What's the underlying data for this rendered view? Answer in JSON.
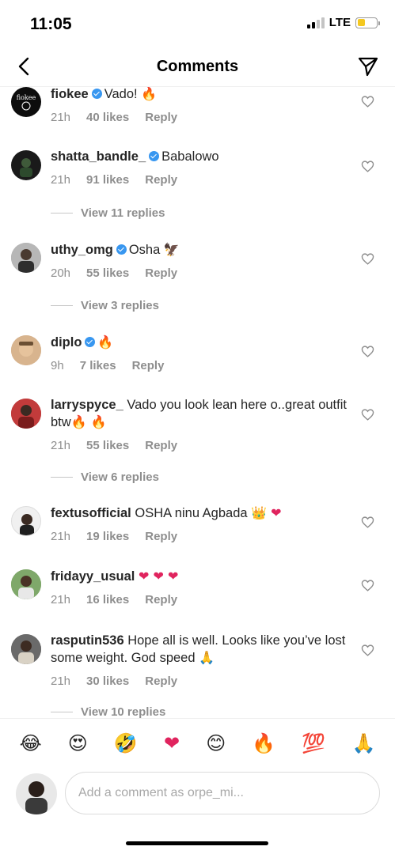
{
  "status": {
    "time": "11:05",
    "network": "LTE",
    "battery_percent": 40,
    "signal_bars": 2,
    "signal_total": 4
  },
  "header": {
    "title": "Comments"
  },
  "colors": {
    "verified": "#3897f0",
    "secondary_text": "#8e8e8e",
    "battery": "#f4c820"
  },
  "comments": [
    {
      "user": "fiokee",
      "verified": true,
      "text": "Vado!",
      "emoji": "🔥",
      "time": "21h",
      "likes": "40 likes",
      "reply": "Reply"
    },
    {
      "user": "shatta_bandle_",
      "verified": true,
      "text": "Babalowo",
      "emoji": "",
      "time": "21h",
      "likes": "91 likes",
      "reply": "Reply",
      "view_replies": "View 11 replies"
    },
    {
      "user": "uthy_omg",
      "verified": true,
      "text": "Osha",
      "emoji": "🦅",
      "time": "20h",
      "likes": "55 likes",
      "reply": "Reply",
      "view_replies": "View 3 replies"
    },
    {
      "user": "diplo",
      "verified": true,
      "text": "",
      "emoji": "🔥",
      "time": "9h",
      "likes": "7 likes",
      "reply": "Reply"
    },
    {
      "user": "larryspyce_",
      "verified": false,
      "text": "Vado you look lean here o..great outfit btw",
      "emoji": "🔥 🔥",
      "time": "21h",
      "likes": "55 likes",
      "reply": "Reply",
      "view_replies": "View 6 replies"
    },
    {
      "user": "fextusofficial",
      "verified": false,
      "text": "OSHA ninu Agbada",
      "emoji": "👑 ❤",
      "time": "21h",
      "likes": "19 likes",
      "reply": "Reply"
    },
    {
      "user": "fridayy_usual",
      "verified": false,
      "text": "",
      "emoji": "❤ ❤ ❤",
      "time": "21h",
      "likes": "16 likes",
      "reply": "Reply"
    },
    {
      "user": "rasputin536",
      "verified": false,
      "text": "Hope all is well. Looks like you’ve lost some weight. God speed",
      "emoji": "🙏",
      "time": "21h",
      "likes": "30 likes",
      "reply": "Reply",
      "view_replies": "View 10 replies"
    }
  ],
  "emoji_bar": [
    "😂",
    "😍",
    "🤣",
    "❤",
    "😊",
    "🔥",
    "💯",
    "🙏"
  ],
  "input": {
    "placeholder": "Add a comment as orpe_mi..."
  },
  "icons": [
    "back-chevron-icon",
    "paper-plane-icon",
    "heart-outline-icon",
    "verified-badge-icon"
  ]
}
